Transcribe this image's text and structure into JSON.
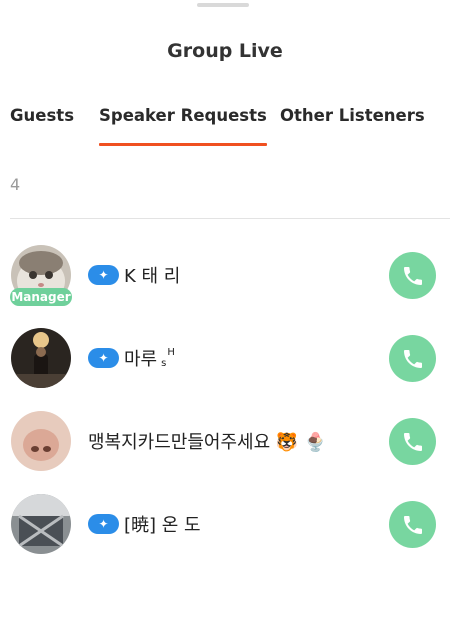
{
  "header": {
    "title": "Group Live"
  },
  "tabs": [
    {
      "label": "Guests"
    },
    {
      "label": "Speaker Requests",
      "active": true
    },
    {
      "label": "Other Listeners"
    }
  ],
  "list": {
    "count": "4",
    "items": [
      {
        "name": "K 태 리",
        "role_badge": "Manager",
        "verified": true
      },
      {
        "name": "마루",
        "suffix_low": "s",
        "suffix_high": "H",
        "verified": true
      },
      {
        "name": "맹복지카드만들어주세요 🐯 🍨",
        "verified": false
      },
      {
        "name": "[暁] 온 도",
        "verified": true
      }
    ]
  },
  "colors": {
    "accent_underline": "#f05020",
    "call_button": "#78d6a0",
    "verified_badge": "#2b8de8",
    "manager_badge": "#6fd09b"
  },
  "icons": {
    "verified": "sparkle-badge-icon",
    "call": "phone-icon"
  }
}
